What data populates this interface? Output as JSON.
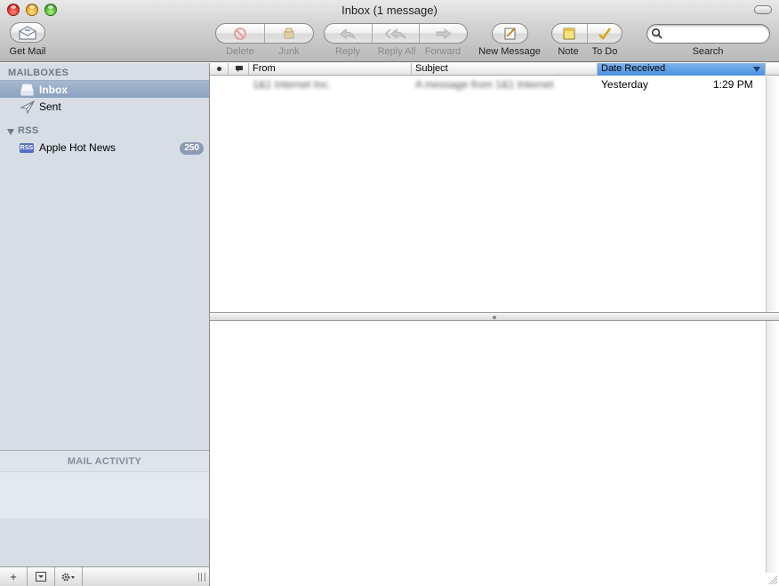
{
  "window": {
    "title": "Inbox (1 message)"
  },
  "toolbar": {
    "get_mail": "Get Mail",
    "delete": "Delete",
    "junk": "Junk",
    "reply": "Reply",
    "reply_all": "Reply All",
    "forward": "Forward",
    "new_message": "New Message",
    "note": "Note",
    "todo": "To Do",
    "search_label": "Search",
    "search_value": ""
  },
  "sidebar": {
    "mailboxes_header": "MAILBOXES",
    "inbox": "Inbox",
    "sent": "Sent",
    "rss_header": "RSS",
    "rss_icon_text": "RSS",
    "apple_hot_news": "Apple Hot News",
    "apple_hot_news_count": "250",
    "mail_activity": "MAIL ACTIVITY"
  },
  "message_list": {
    "columns": {
      "from": "From",
      "subject": "Subject",
      "date_received": "Date Received"
    },
    "rows": [
      {
        "from": "1&1 Internet Inc.",
        "subject": "A message from 1&1 Internet",
        "date": "Yesterday",
        "time": "1:29 PM"
      }
    ]
  },
  "colors": {
    "selected_sidebar": "#8ba2bf",
    "sidebar_bg": "#d6dde5",
    "sorted_column": "#4a8fe0"
  }
}
